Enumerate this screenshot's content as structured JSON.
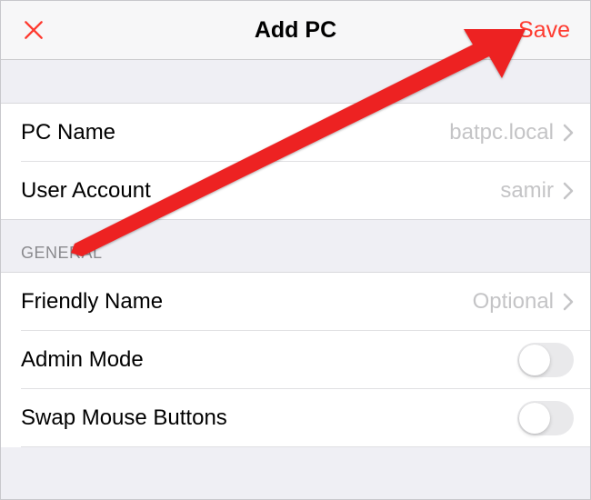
{
  "navbar": {
    "title": "Add PC",
    "save_label": "Save"
  },
  "rows": {
    "pc_name": {
      "label": "PC Name",
      "value": "batpc.local"
    },
    "user_account": {
      "label": "User Account",
      "value": "samir"
    },
    "friendly_name": {
      "label": "Friendly Name",
      "value": "Optional"
    },
    "admin_mode": {
      "label": "Admin Mode"
    },
    "swap_mouse": {
      "label": "Swap Mouse Buttons"
    }
  },
  "sections": {
    "general": "GENERAL"
  }
}
